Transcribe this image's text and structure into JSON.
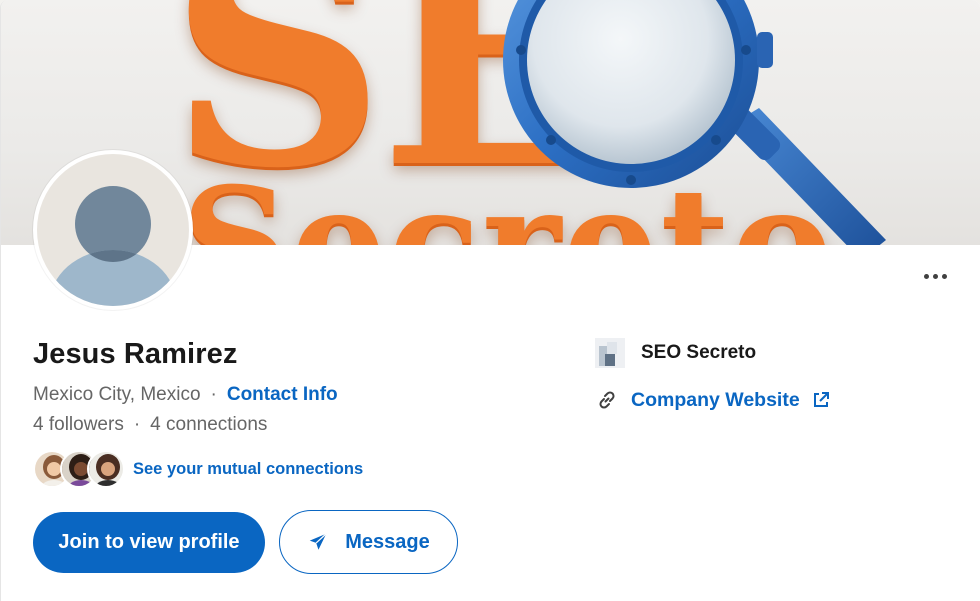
{
  "cover": {
    "brand_word_top": "SE",
    "brand_word_bottom": "Secreto",
    "brand_color": "#f07c2c",
    "magnifier_color": "#2c6fc4"
  },
  "profile": {
    "name": "Jesus Ramirez",
    "location": "Mexico City, Mexico",
    "separator": "·",
    "contact_info_label": "Contact Info",
    "followers": "4 followers",
    "connections": "4 connections",
    "mutual_connections_label": "See your mutual connections"
  },
  "actions": {
    "join_label": "Join to view profile",
    "message_label": "Message",
    "more_icon": "ellipsis-icon"
  },
  "sidebar": {
    "company_name": "SEO Secreto",
    "website_label": "Company Website",
    "link_icon": "link-icon",
    "external_icon": "external-link-icon"
  },
  "colors": {
    "accent": "#0a66c2",
    "text_primary": "#191919",
    "text_secondary": "#666666"
  }
}
